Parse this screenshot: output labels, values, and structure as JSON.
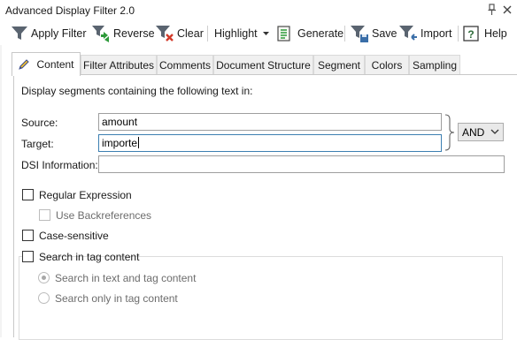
{
  "window": {
    "title": "Advanced Display Filter 2.0",
    "pin_icon": "pin-icon",
    "close_icon": "close-icon"
  },
  "toolbar": {
    "apply_filter": "Apply Filter",
    "reverse": "Reverse",
    "clear": "Clear",
    "highlight": "Highlight",
    "generate": "Generate",
    "save": "Save",
    "import": "Import",
    "help": "Help"
  },
  "tabs": [
    {
      "label": "Content",
      "active": true
    },
    {
      "label": "Filter Attributes"
    },
    {
      "label": "Comments"
    },
    {
      "label": "Document Structure"
    },
    {
      "label": "Segment"
    },
    {
      "label": "Colors"
    },
    {
      "label": "Sampling"
    }
  ],
  "content": {
    "intro": "Display segments containing the following text in:",
    "source_label": "Source:",
    "source_value": "amount",
    "target_label": "Target:",
    "target_value": "importe",
    "dsi_label": "DSI Information:",
    "dsi_value": "",
    "operator": "AND",
    "regex_label": "Regular Expression",
    "backrefs_label": "Use Backreferences",
    "case_label": "Case-sensitive",
    "tag_group_label": "Search in tag content",
    "radio_text_and_tag": "Search in text and tag content",
    "radio_tag_only": "Search only in tag content"
  },
  "colors": {
    "filter_icon_gray": "#5a6470",
    "green_arrow": "#2e9a3a",
    "red_x": "#d23a2a",
    "focus_border": "#3c7fb1"
  }
}
